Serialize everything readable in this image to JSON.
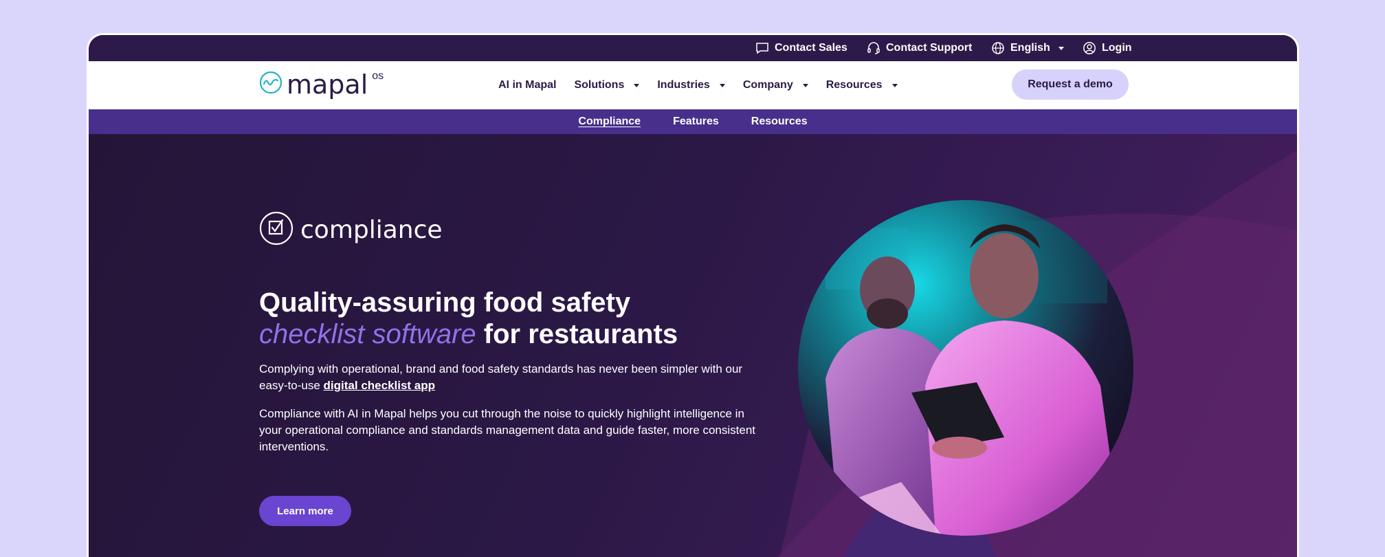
{
  "utility": {
    "contact_sales": "Contact Sales",
    "contact_support": "Contact Support",
    "language": "English",
    "login": "Login"
  },
  "brand": {
    "name": "mapal",
    "suffix": "os"
  },
  "nav": {
    "items": [
      "AI in Mapal",
      "Solutions",
      "Industries",
      "Company",
      "Resources"
    ],
    "demo": "Request a demo"
  },
  "subnav": {
    "items": [
      "Compliance",
      "Features",
      "Resources"
    ],
    "active": "Compliance"
  },
  "hero": {
    "product": "compliance",
    "heading_line1": "Quality-assuring food safety",
    "heading_accent": "checklist software",
    "heading_tail": " for restaurants",
    "para1_text": "Complying with operational, brand and food safety standards has never been simpler with our easy-to-use ",
    "para1_link": "digital checklist app",
    "para2": "Compliance with AI in Mapal helps you cut through the noise to quickly highlight intelligence in your operational compliance and standards management data and guide faster, more consistent interventions.",
    "cta": "Learn more"
  },
  "colors": {
    "page_bg": "#d9d5fb",
    "topbar": "#2e1a4a",
    "subnav": "#472f8b",
    "accent": "#8e73e8",
    "button": "#6a45d1",
    "demo_button": "#d6d2fb",
    "logo_teal": "#20b5c4"
  },
  "icons": {
    "contact_sales": "chat-bubble-icon",
    "contact_support": "headset-icon",
    "language": "globe-icon",
    "login": "user-circle-icon",
    "product": "checkbox-circle-icon",
    "logo": "wave-circle-icon"
  }
}
